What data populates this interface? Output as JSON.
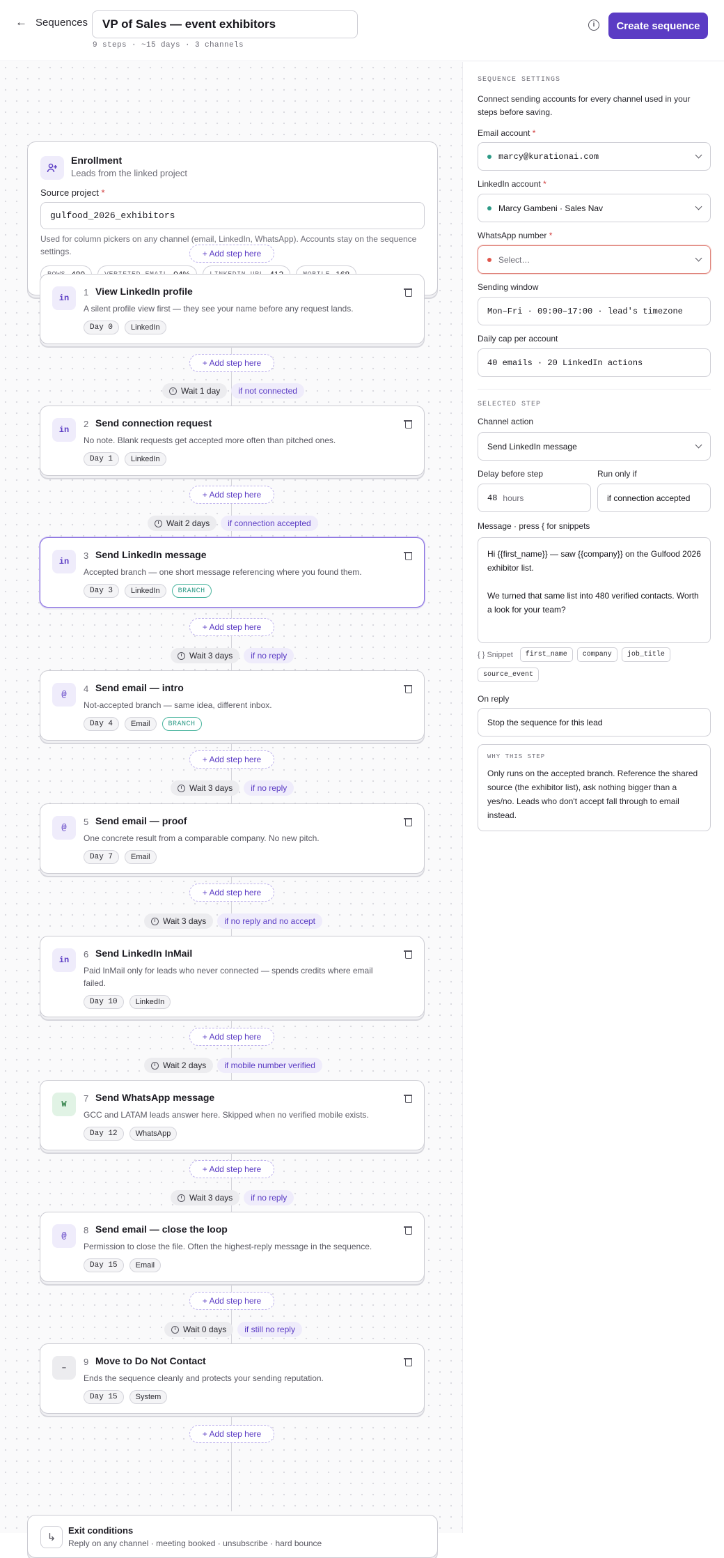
{
  "header": {
    "back_label": "Sequences",
    "title": "VP of Sales — event exhibitors",
    "meta": "9 steps · ~15 days · 3 channels",
    "create_label": "Create sequence"
  },
  "enrollment": {
    "title": "Enrollment",
    "subtitle": "Leads from the linked project",
    "source_label": "Source project",
    "source_value": "gulfood_2026_exhibitors",
    "help": "Used for column pickers on any channel (email, LinkedIn, WhatsApp). Accounts stay on the sequence settings.",
    "stats": [
      {
        "key": "ROWS",
        "value": "480"
      },
      {
        "key": "VERIFIED EMAIL",
        "value": "94%"
      },
      {
        "key": "LINKEDIN URL",
        "value": "412"
      },
      {
        "key": "MOBILE",
        "value": "168"
      }
    ]
  },
  "add_step_label": "+ Add step here",
  "steps": [
    {
      "num": "1",
      "icon": "in",
      "title": "View LinkedIn profile",
      "desc": "A silent profile view first — they see your name before any request lands.",
      "day": "Day 0",
      "channel": "LinkedIn"
    },
    {
      "num": "2",
      "icon": "in",
      "title": "Send connection request",
      "desc": "No note. Blank requests get accepted more often than pitched ones.",
      "day": "Day 1",
      "channel": "LinkedIn"
    },
    {
      "num": "3",
      "icon": "in",
      "title": "Send LinkedIn message",
      "desc": "Accepted branch — one short message referencing where you found them.",
      "day": "Day 3",
      "channel": "LinkedIn",
      "branch": "BRANCH"
    },
    {
      "num": "4",
      "icon": "@",
      "title": "Send email — intro",
      "desc": "Not-accepted branch — same idea, different inbox.",
      "day": "Day 4",
      "channel": "Email",
      "branch": "BRANCH"
    },
    {
      "num": "5",
      "icon": "@",
      "title": "Send email — proof",
      "desc": "One concrete result from a comparable company. No new pitch.",
      "day": "Day 7",
      "channel": "Email"
    },
    {
      "num": "6",
      "icon": "in",
      "title": "Send LinkedIn InMail",
      "desc": "Paid InMail only for leads who never connected — spends credits where email failed.",
      "day": "Day 10",
      "channel": "LinkedIn"
    },
    {
      "num": "7",
      "icon": "W",
      "title": "Send WhatsApp message",
      "desc": "GCC and LATAM leads answer here. Skipped when no verified mobile exists.",
      "day": "Day 12",
      "channel": "WhatsApp"
    },
    {
      "num": "8",
      "icon": "@",
      "title": "Send email — close the loop",
      "desc": "Permission to close the file. Often the highest-reply message in the sequence.",
      "day": "Day 15",
      "channel": "Email"
    },
    {
      "num": "9",
      "icon": "–",
      "title": "Move to Do Not Contact",
      "desc": "Ends the sequence cleanly and protects your sending reputation.",
      "day": "Day 15",
      "channel": "System"
    }
  ],
  "waits": [
    {
      "wait": "Wait 1 day",
      "cond": "if not connected"
    },
    {
      "wait": "Wait 2 days",
      "cond": "if connection accepted"
    },
    {
      "wait": "Wait 3 days",
      "cond": "if no reply"
    },
    {
      "wait": "Wait 3 days",
      "cond": "if no reply"
    },
    {
      "wait": "Wait 3 days",
      "cond": "if no reply and no accept"
    },
    {
      "wait": "Wait 2 days",
      "cond": "if mobile number verified"
    },
    {
      "wait": "Wait 3 days",
      "cond": "if no reply"
    },
    {
      "wait": "Wait 0 days",
      "cond": "if still no reply"
    }
  ],
  "exit": {
    "title": "Exit conditions",
    "subtitle": "Reply on any channel · meeting booked · unsubscribe · hard bounce"
  },
  "settings": {
    "section": "SEQUENCE SETTINGS",
    "intro": "Connect sending accounts for every channel used in your steps before saving.",
    "email_label": "Email account",
    "email_value": "marcy@kurationai.com",
    "linkedin_label": "LinkedIn account",
    "linkedin_value": "Marcy Gambeni · Sales Nav",
    "whatsapp_label": "WhatsApp number",
    "whatsapp_placeholder": "Select…",
    "window_label": "Sending window",
    "window_value": "Mon–Fri · 09:00–17:00 · lead's timezone",
    "cap_label": "Daily cap per account",
    "cap_value": "40 emails · 20 LinkedIn actions"
  },
  "selected": {
    "section": "SELECTED STEP",
    "action_label": "Channel action",
    "action_value": "Send LinkedIn message",
    "delay_label": "Delay before step",
    "delay_value": "48",
    "delay_unit": "hours",
    "runif_label": "Run only if",
    "runif_value": "if connection accepted",
    "message_label": "Message · press { for snippets",
    "message_p1": "Hi {{first_name}} — saw {{company}} on the Gulfood 2026 exhibitor list.",
    "message_p2": "We turned that same list into 480 verified contacts. Worth a look for your team?",
    "snippet_label": "{ } Snippet",
    "snippets": [
      "first_name",
      "company",
      "job_title",
      "source_event"
    ],
    "reply_label": "On reply",
    "reply_value": "Stop the sequence for this lead",
    "why_heading": "WHY THIS STEP",
    "why_body": "Only runs on the accepted branch. Reference the shared source (the exhibitor list), ask nothing bigger than a yes/no. Leads who don't accept fall through to email instead."
  },
  "colors": {
    "accent": "#5b3cc4",
    "branch": "#2c9a86",
    "error": "#e0867e",
    "status_ok": "#2c9a86"
  }
}
